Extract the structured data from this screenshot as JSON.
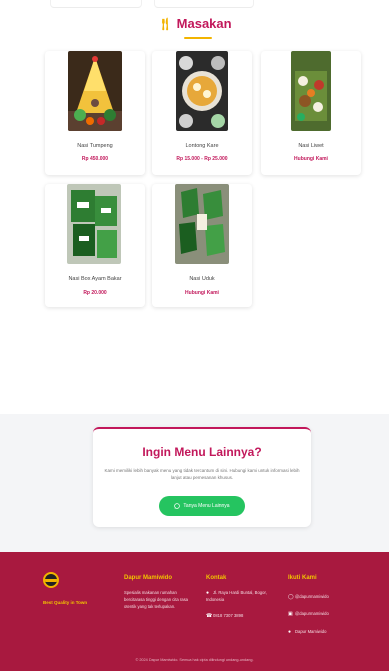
{
  "section": {
    "title": "Masakan",
    "icon": "fork-knife-icon"
  },
  "menu_items": [
    {
      "name": "Nasi Tumpeng",
      "price": "Rp 450.000"
    },
    {
      "name": "Lontong Kare",
      "price": "Rp 15.000 - Rp 25.000"
    },
    {
      "name": "Nasi Liwet",
      "price": "Hubungi Kami"
    },
    {
      "name": "Nasi Box Ayam Bakar",
      "price": "Rp 20.000"
    },
    {
      "name": "Nasi Uduk",
      "price": "Hubungi Kami"
    }
  ],
  "cta": {
    "title": "Ingin Menu Lainnya?",
    "text": "Kami memiliki lebih banyak menu yang tidak tercantum di sini. Hubungi kami untuk informasi lebih lanjut atau pemesanan khusus.",
    "button_label": "Tanya Menu Lainnya",
    "button_icon": "whatsapp-icon"
  },
  "footer": {
    "tagline": "Best Quality in Town",
    "about": {
      "heading": "Dapur Mamiwido",
      "text": "Spesialis makanan rumahan bercitarasa tinggi dengan cita rasa otentik yang tak terlupakan."
    },
    "contact": {
      "heading": "Kontak",
      "address": "Jl. Raya Hardi Buntal, Bogor, Indonesia",
      "phone": "0818 7307 3898"
    },
    "social": {
      "heading": "Ikuti Kami",
      "items": [
        "@dapurmamiwido",
        "@dapurmamiwido",
        "Dapur Mamiwido"
      ]
    },
    "copyright": "© 2024 Dapur Mamiwido. Semua hak cipta dilindungi undang-undang."
  },
  "colors": {
    "brand": "#c2185b",
    "accent": "#f2b400",
    "footer": "#a8193f",
    "whatsapp": "#25c460"
  }
}
